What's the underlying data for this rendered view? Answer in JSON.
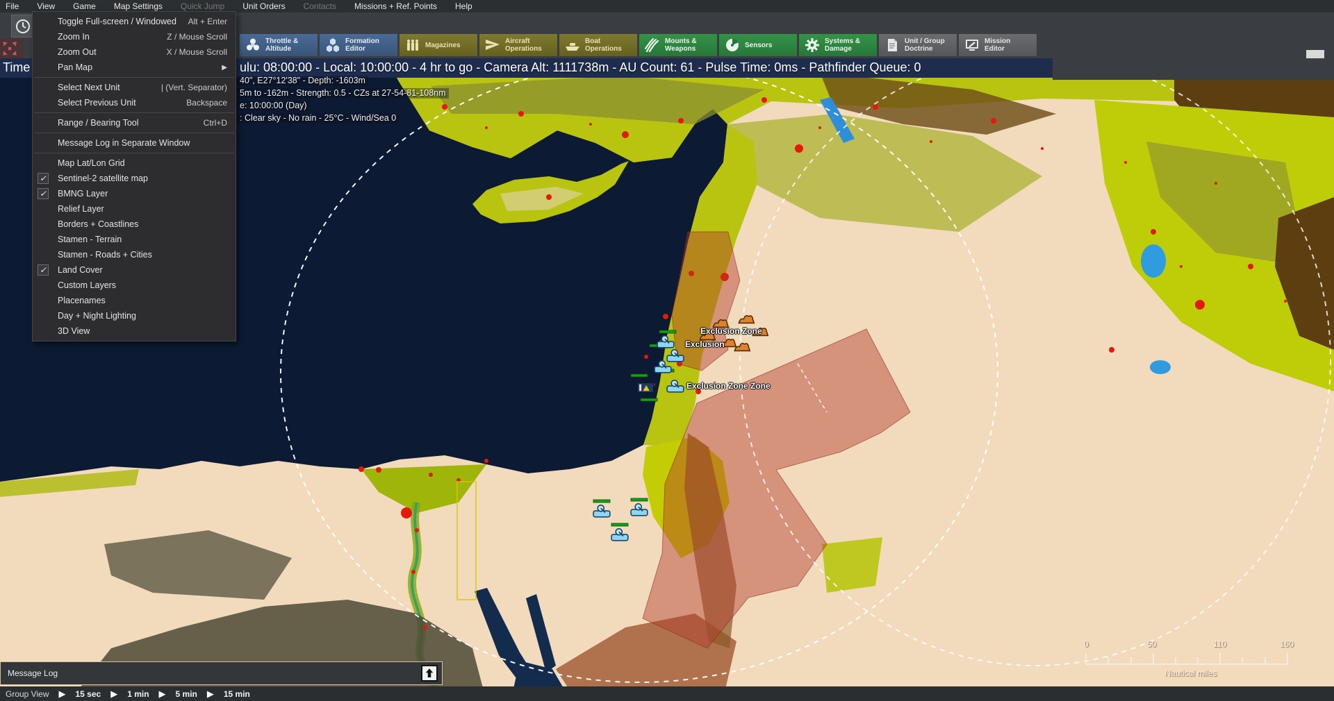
{
  "menu_bar": {
    "items": [
      {
        "label": "File",
        "enabled": true
      },
      {
        "label": "View",
        "enabled": true
      },
      {
        "label": "Game",
        "enabled": true
      },
      {
        "label": "Map Settings",
        "enabled": true
      },
      {
        "label": "Quick Jump",
        "enabled": false
      },
      {
        "label": "Unit Orders",
        "enabled": true
      },
      {
        "label": "Contacts",
        "enabled": false
      },
      {
        "label": "Missions + Ref. Points",
        "enabled": true
      },
      {
        "label": "Help",
        "enabled": true
      }
    ]
  },
  "view_menu": {
    "items": [
      {
        "label": "Toggle Full-screen / Windowed",
        "shortcut": "Alt + Enter",
        "checked": false
      },
      {
        "label": "Zoom In",
        "shortcut": "Z / Mouse Scroll",
        "checked": false
      },
      {
        "label": "Zoom Out",
        "shortcut": "X / Mouse Scroll",
        "checked": false
      },
      {
        "label": "Pan Map",
        "shortcut": "",
        "checked": false,
        "has_submenu": true
      },
      {
        "label": "Select Next Unit",
        "shortcut": "| (Vert. Separator)",
        "checked": false
      },
      {
        "label": "Select Previous Unit",
        "shortcut": "Backspace",
        "checked": false
      },
      {
        "label": "Range / Bearing Tool",
        "shortcut": "Ctrl+D",
        "checked": false
      },
      {
        "label": "Message Log in Separate Window",
        "shortcut": "",
        "checked": false
      },
      {
        "label": "Map Lat/Lon Grid",
        "shortcut": "",
        "checked": false
      },
      {
        "label": "Sentinel-2 satellite map",
        "shortcut": "",
        "checked": true
      },
      {
        "label": "BMNG Layer",
        "shortcut": "",
        "checked": true
      },
      {
        "label": "Relief Layer",
        "shortcut": "",
        "checked": false
      },
      {
        "label": "Borders + Coastlines",
        "shortcut": "",
        "checked": false
      },
      {
        "label": "Stamen - Terrain",
        "shortcut": "",
        "checked": false
      },
      {
        "label": "Stamen - Roads + Cities",
        "shortcut": "",
        "checked": false
      },
      {
        "label": "Land Cover",
        "shortcut": "",
        "checked": true
      },
      {
        "label": "Custom Layers",
        "shortcut": "",
        "checked": false
      },
      {
        "label": "Placenames",
        "shortcut": "",
        "checked": false
      },
      {
        "label": "Day + Night Lighting",
        "shortcut": "",
        "checked": false
      },
      {
        "label": "3D View",
        "shortcut": "",
        "checked": false
      }
    ]
  },
  "toolbar": {
    "buttons": [
      {
        "line1": "Throttle &",
        "line2": "Altitude",
        "style": "blue",
        "icon": "throttle-icon"
      },
      {
        "line1": "Formation",
        "line2": "Editor",
        "style": "blue",
        "icon": "formation-icon"
      },
      {
        "line1": "Magazines",
        "line2": "",
        "style": "olive",
        "icon": "magazines-icon"
      },
      {
        "line1": "Aircraft",
        "line2": "Operations",
        "style": "olive",
        "icon": "aircraft-icon"
      },
      {
        "line1": "Boat",
        "line2": "Operations",
        "style": "olive",
        "icon": "boat-icon"
      },
      {
        "line1": "Mounts &",
        "line2": "Weapons",
        "style": "green",
        "icon": "mounts-icon"
      },
      {
        "line1": "Sensors",
        "line2": "",
        "style": "green",
        "icon": "sensors-icon"
      },
      {
        "line1": "Systems &",
        "line2": "Damage",
        "style": "green",
        "icon": "systems-icon"
      },
      {
        "line1": "Unit / Group",
        "line2": "Doctrine",
        "style": "gray",
        "icon": "doctrine-icon"
      },
      {
        "line1": "Mission",
        "line2": "Editor",
        "style": "gray",
        "icon": "mission-icon"
      }
    ]
  },
  "status_bar": {
    "time_label": "Time",
    "main_text": "ulu: 08:00:00 - Local: 10:00:00 - 4 hr to go -  Camera Alt: 1111738m - AU Count: 61 - Pulse Time: 0ms - Pathfinder Queue: 0"
  },
  "map_info": {
    "line1": "40\", E27°12'38\" - Depth: -1603m",
    "line2": "5m to -162m - Strength: 0.5 - CZs at 27-54-81-108nm",
    "line3": "e: 10:00:00 (Day)",
    "line4": ": Clear sky - No rain - 25°C - Wind/Sea 0"
  },
  "map": {
    "labels": [
      {
        "text": "Exclusion Zone"
      },
      {
        "text": "Exclusion"
      },
      {
        "text": "Exclusion Zone Zone"
      }
    ]
  },
  "scale_bar": {
    "ticks": [
      "0",
      "50",
      "110",
      "160"
    ],
    "unit": "Nautical miles"
  },
  "message_log": {
    "title": "Message Log"
  },
  "time_controls": {
    "mode_label": "Group View",
    "steps": [
      "15 sec",
      "1 min",
      "5 min",
      "15 min"
    ]
  },
  "colors": {
    "navy_bar": "#1e2c4e",
    "sea": "#0c1b33",
    "desert": "#f2dabd",
    "vegetation": "#bcc70d",
    "urban": "#e41907",
    "exclusion_zone": "#b23c2d",
    "toolbar_blue": "#41628c",
    "toolbar_olive": "#73702a",
    "toolbar_green": "#2e8742",
    "toolbar_gray": "#5f6163"
  }
}
